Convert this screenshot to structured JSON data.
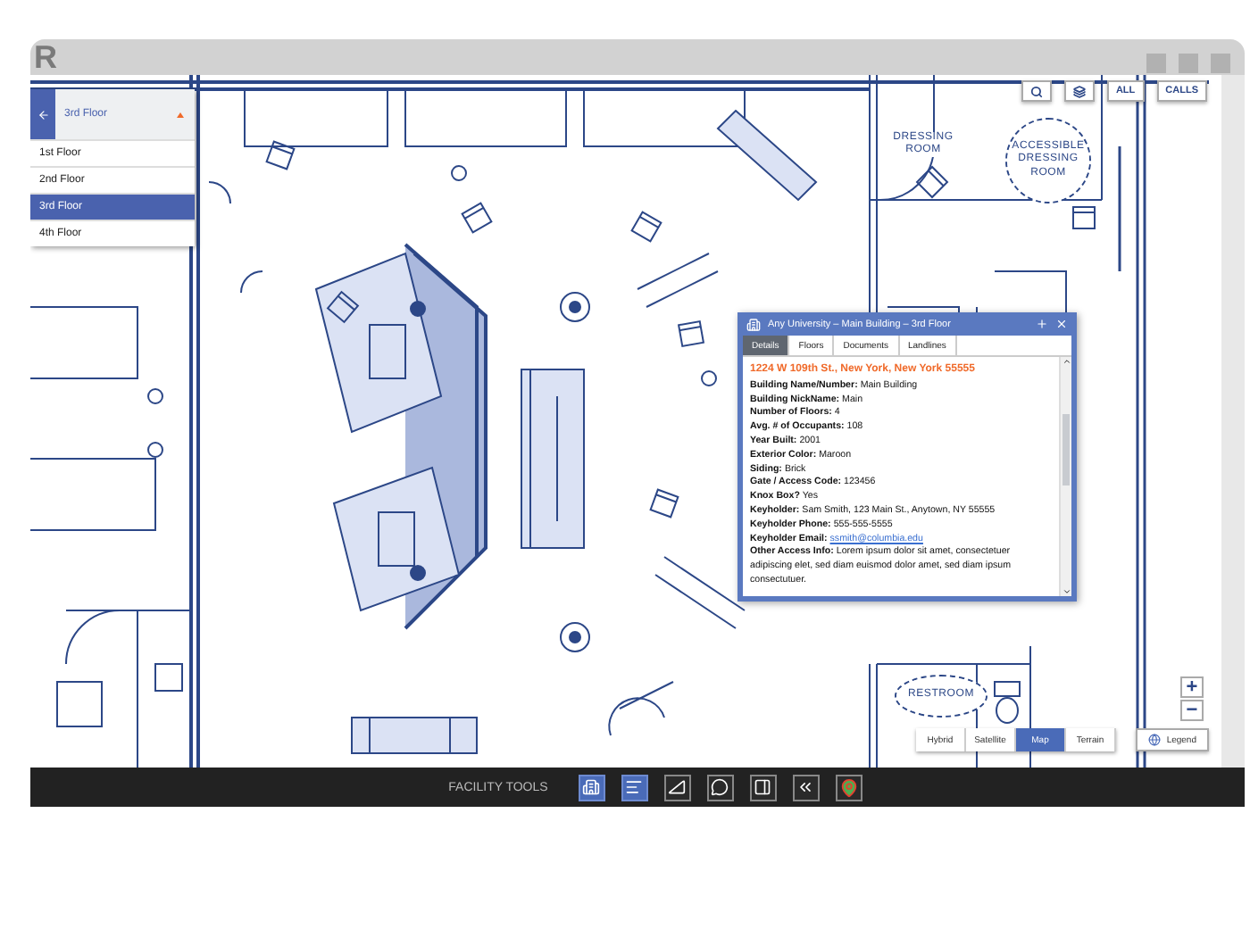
{
  "app": {
    "logo": "R"
  },
  "floor_selector": {
    "current": "3rd Floor",
    "floors": [
      {
        "label": "1st Floor",
        "selected": false
      },
      {
        "label": "2nd Floor",
        "selected": false
      },
      {
        "label": "3rd Floor",
        "selected": true
      },
      {
        "label": "4th Floor",
        "selected": false
      }
    ]
  },
  "map_buttons": [
    {
      "kind": "icon"
    },
    {
      "kind": "icon"
    },
    {
      "kind": "text",
      "label": "ALL"
    },
    {
      "kind": "text",
      "label": "CALLS"
    }
  ],
  "room_labels": [
    {
      "text": "DRESSING ROOM",
      "dashed": false
    },
    {
      "text": "ACCESSIBLE DRESSING ROOM",
      "dashed": true
    },
    {
      "text": "RESTROOM",
      "dashed": true
    }
  ],
  "info_popup": {
    "title": "Any University – Main Building – 3rd Floor",
    "tabs": [
      {
        "label": "Details",
        "selected": true
      },
      {
        "label": "Floors",
        "selected": false
      },
      {
        "label": "Documents",
        "selected": false
      },
      {
        "label": "Landlines",
        "selected": false
      }
    ],
    "address": "1224 W 109th St., New York, New York 55555",
    "fields": [
      {
        "label": "Building Name/Number:",
        "value": "Main Building",
        "kind": "text"
      },
      {
        "label": "Building NickName:",
        "value": "Main",
        "kind": "text"
      },
      {
        "label": "Number of Floors:",
        "value": "4",
        "kind": "text"
      },
      {
        "label": "Avg. # of Occupants:",
        "value": "108",
        "kind": "text"
      },
      {
        "label": "Year Built:",
        "value": "2001",
        "kind": "text"
      },
      {
        "label": "Exterior Color:",
        "value": "Maroon",
        "kind": "text"
      },
      {
        "label": "Siding:",
        "value": "Brick",
        "kind": "text"
      },
      {
        "label": "Gate / Access Code:",
        "value": "123456",
        "kind": "text"
      },
      {
        "label": "Knox Box?",
        "value": "Yes",
        "kind": "text"
      },
      {
        "label": "Keyholder:",
        "value": "Sam Smith, 123 Main St., Anytown, NY 55555",
        "kind": "text"
      },
      {
        "label": "Keyholder Phone:",
        "value": "555-555-5555",
        "kind": "text"
      },
      {
        "label": "Keyholder Email:",
        "value": "ssmith@columbia.edu",
        "kind": "link"
      },
      {
        "label": "Other Access Info:",
        "value": "Lorem ipsum dolor sit amet, consectetuer adipiscing elet, sed diam euismod dolor amet, sed diam ipsum consectutuer.",
        "kind": "text"
      }
    ]
  },
  "map_types": [
    {
      "label": "Hybrid",
      "selected": false
    },
    {
      "label": "Satellite",
      "selected": false
    },
    {
      "label": "Map",
      "selected": true
    },
    {
      "label": "Terrain",
      "selected": false
    }
  ],
  "zoom": {
    "in": "+",
    "out": "−"
  },
  "legend": {
    "label": "Legend"
  },
  "toolbar": {
    "label": "FACILITY TOOLS",
    "tools": [
      {
        "active": true
      },
      {
        "active": true
      },
      {
        "active": false
      },
      {
        "active": false
      },
      {
        "active": false
      },
      {
        "active": false
      },
      {
        "active": false
      }
    ]
  }
}
